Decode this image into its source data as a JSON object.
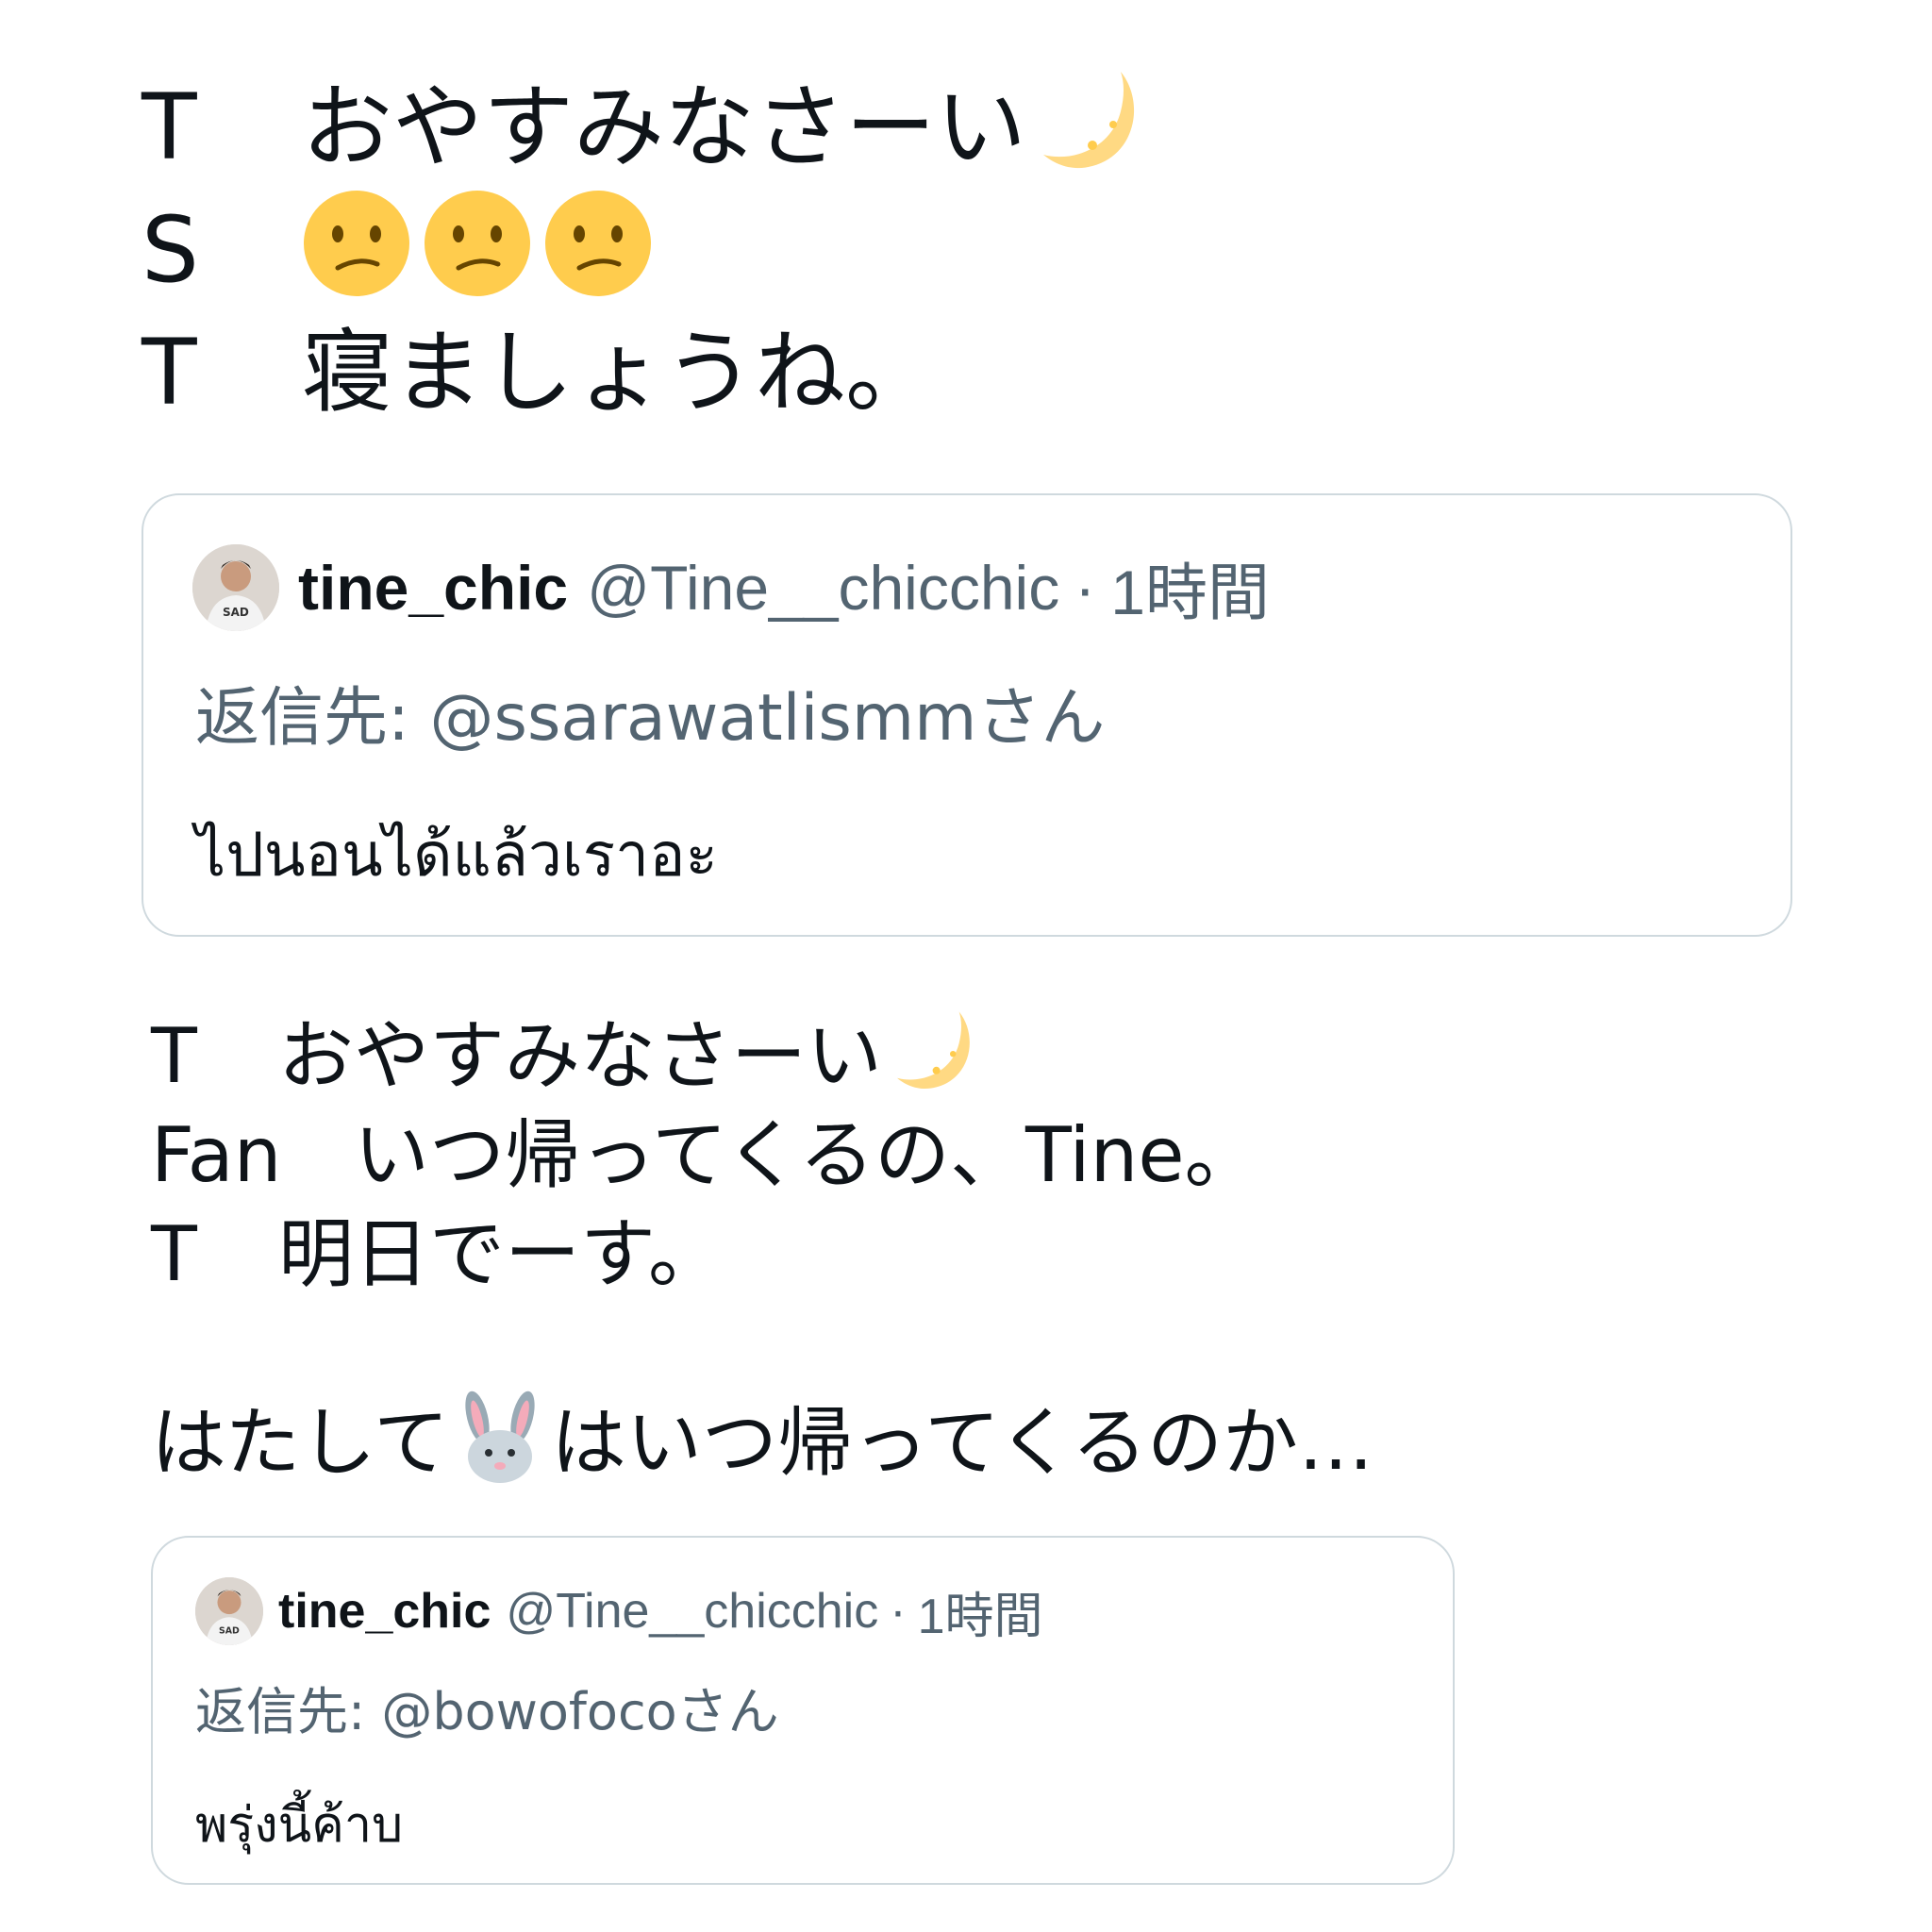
{
  "section1": {
    "lines": [
      {
        "speaker": "T",
        "text": "おやすみなさーい",
        "emoji": "crescent-moon"
      },
      {
        "speaker": "S",
        "emoji": "confused-face",
        "emoji_count": 3
      },
      {
        "speaker": "T",
        "text": "寝ましょうね。"
      }
    ]
  },
  "quote1": {
    "author_name": "tine_chic",
    "author_handle": "@Tine__chicchic",
    "separator": "·",
    "time": "1時間",
    "reply_prefix": "返信先:",
    "reply_to": "@ssarawatlismmさん",
    "body": "ไปนอนได้แล้วเราอะ"
  },
  "section2": {
    "lines": [
      {
        "speaker": "T",
        "text": "おやすみなさーい",
        "emoji": "crescent-moon"
      },
      {
        "speaker": "Fan",
        "text": "いつ帰ってくるの、Tine。"
      },
      {
        "speaker": "T",
        "text": "明日でーす。"
      }
    ],
    "closing_before": "はたして",
    "closing_emoji": "rabbit-face",
    "closing_after": "はいつ帰ってくるのか…"
  },
  "quote2": {
    "author_name": "tine_chic",
    "author_handle": "@Tine__chicchic",
    "separator": "·",
    "time": "1時間",
    "reply_prefix": "返信先:",
    "reply_to": "@bowofocoさん",
    "body": "พรุ่งนี้ค้าบ"
  },
  "colors": {
    "text": "#0f1419",
    "secondary": "#536471",
    "border": "#cfd9de",
    "emoji_yellow": "#ffcc4d",
    "moon": "#ffd983"
  }
}
